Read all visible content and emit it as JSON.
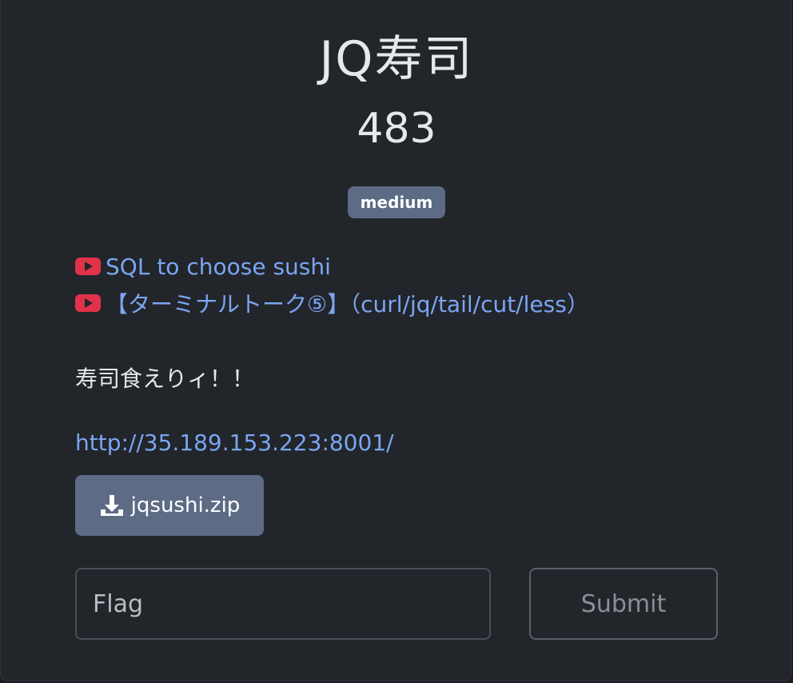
{
  "challenge": {
    "title": "JQ寿司",
    "points": "483",
    "difficulty": "medium",
    "links": [
      {
        "label": "SQL to choose sushi",
        "icon": "youtube-icon"
      },
      {
        "label": "【ターミナルトーク⑤】（curl/jq/tail/cut/less）",
        "icon": "youtube-icon"
      }
    ],
    "description": "寿司食えりィ！！",
    "url": "http://35.189.153.223:8001/",
    "download": {
      "label": "jqsushi.zip",
      "icon": "download-icon"
    }
  },
  "form": {
    "flag_placeholder": "Flag",
    "submit_label": "Submit"
  },
  "colors": {
    "background": "#22252a",
    "link": "#7aa6f2",
    "badge": "#5d6b85",
    "youtube": "#e0334a"
  }
}
